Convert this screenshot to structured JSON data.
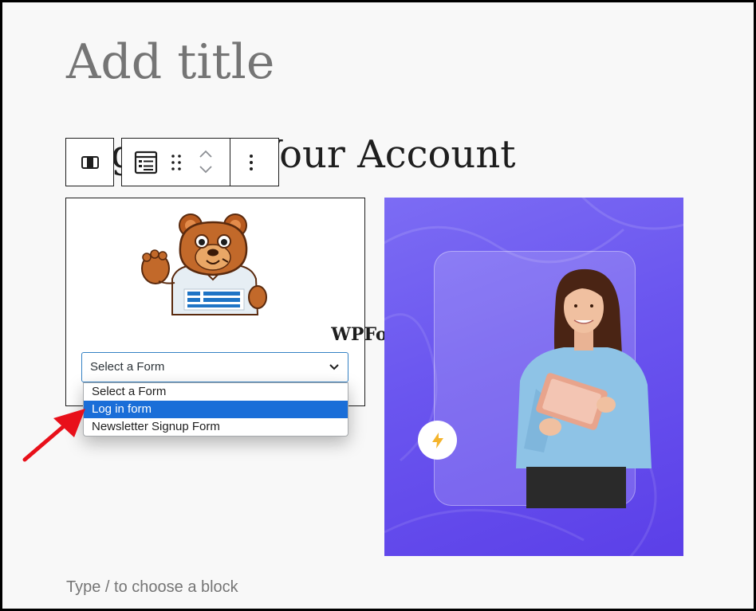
{
  "editor": {
    "title_placeholder": "Add title",
    "heading_text": "g In To Your Account",
    "block_placeholder": "Type / to choose a block"
  },
  "toolbar": {
    "parent_icon": "columns-icon",
    "block_icon": "form-icon",
    "drag_icon": "drag-handle-icon",
    "move_icons": [
      "chevron-up-icon",
      "chevron-down-icon"
    ],
    "more_icon": "more-vertical-icon"
  },
  "wpforms_block": {
    "brand_name": "WPForms",
    "mascot_icon": "wpforms-bear-icon",
    "select": {
      "value": "Select a Form",
      "options": [
        "Select a Form",
        "Log in form",
        "Newsletter Signup Form"
      ],
      "highlighted_index": 1
    }
  },
  "hero_image": {
    "badge_icon": "lightning-bolt-icon"
  },
  "annotation": {
    "arrow_color": "#e8101a"
  },
  "colors": {
    "highlight": "#1a6ed8",
    "select_border": "#3582c4",
    "hero_bg": "#6a55ef"
  }
}
